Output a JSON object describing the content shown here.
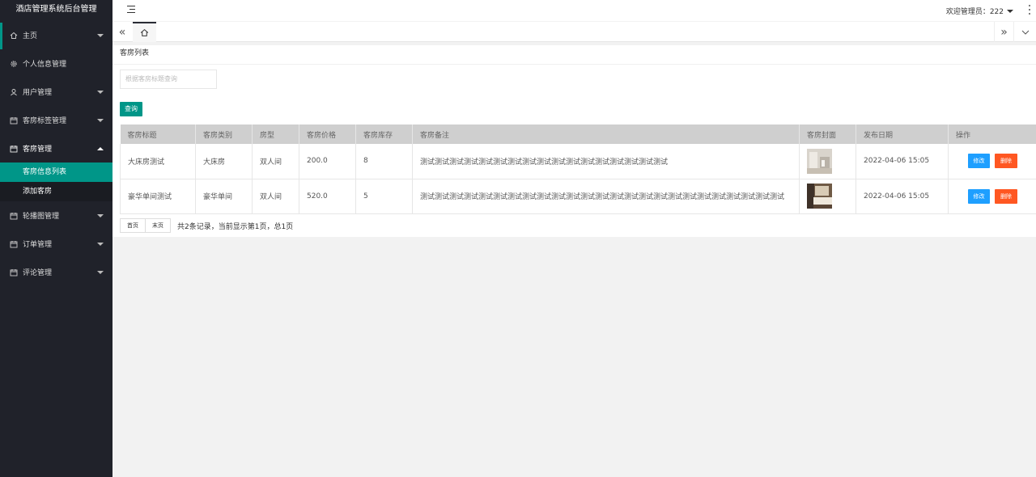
{
  "app": {
    "title": "酒店管理系统后台管理"
  },
  "header": {
    "admin_label": "欢迎管理员：222"
  },
  "sidebar": {
    "items": [
      {
        "label": "主页",
        "icon": "home-icon"
      },
      {
        "label": "个人信息管理",
        "icon": "gear-icon"
      },
      {
        "label": "用户管理",
        "icon": "user-icon"
      },
      {
        "label": "客房标签管理",
        "icon": "calendar-icon"
      },
      {
        "label": "客房管理",
        "icon": "calendar-icon"
      },
      {
        "label": "轮播图管理",
        "icon": "calendar-icon"
      },
      {
        "label": "订单管理",
        "icon": "calendar-icon"
      },
      {
        "label": "评论管理",
        "icon": "calendar-icon"
      }
    ],
    "sub_items": [
      {
        "label": "客房信息列表"
      },
      {
        "label": "添加客房"
      }
    ]
  },
  "page": {
    "title": "客房列表",
    "search_placeholder": "根据客房标题查询",
    "query_label": "查询"
  },
  "table": {
    "headers": [
      "客房标题",
      "客房类别",
      "房型",
      "客房价格",
      "客房库存",
      "客房备注",
      "客房封面",
      "发布日期",
      "操作"
    ],
    "rows": [
      {
        "title": "大床房测试",
        "category": "大床房",
        "type": "双人间",
        "price": "200.0",
        "stock": "8",
        "remark": "测试测试测试测试测试测试测试测试测试测试测试测试测试测试测试测试测试",
        "date": "2022-04-06 15:05",
        "edit": "修改",
        "delete": "删除"
      },
      {
        "title": "豪华单间测试",
        "category": "豪华单间",
        "type": "双人间",
        "price": "520.0",
        "stock": "5",
        "remark": "测试测试测试测试测试测试测试测试测试测试测试测试测试测试测试测试测试测试测试测试测试测试测试测试测试",
        "date": "2022-04-06 15:05",
        "edit": "修改",
        "delete": "删除"
      }
    ]
  },
  "pager": {
    "first": "首页",
    "last": "末页",
    "info": "共2条记录，当前显示第1页，总1页"
  }
}
